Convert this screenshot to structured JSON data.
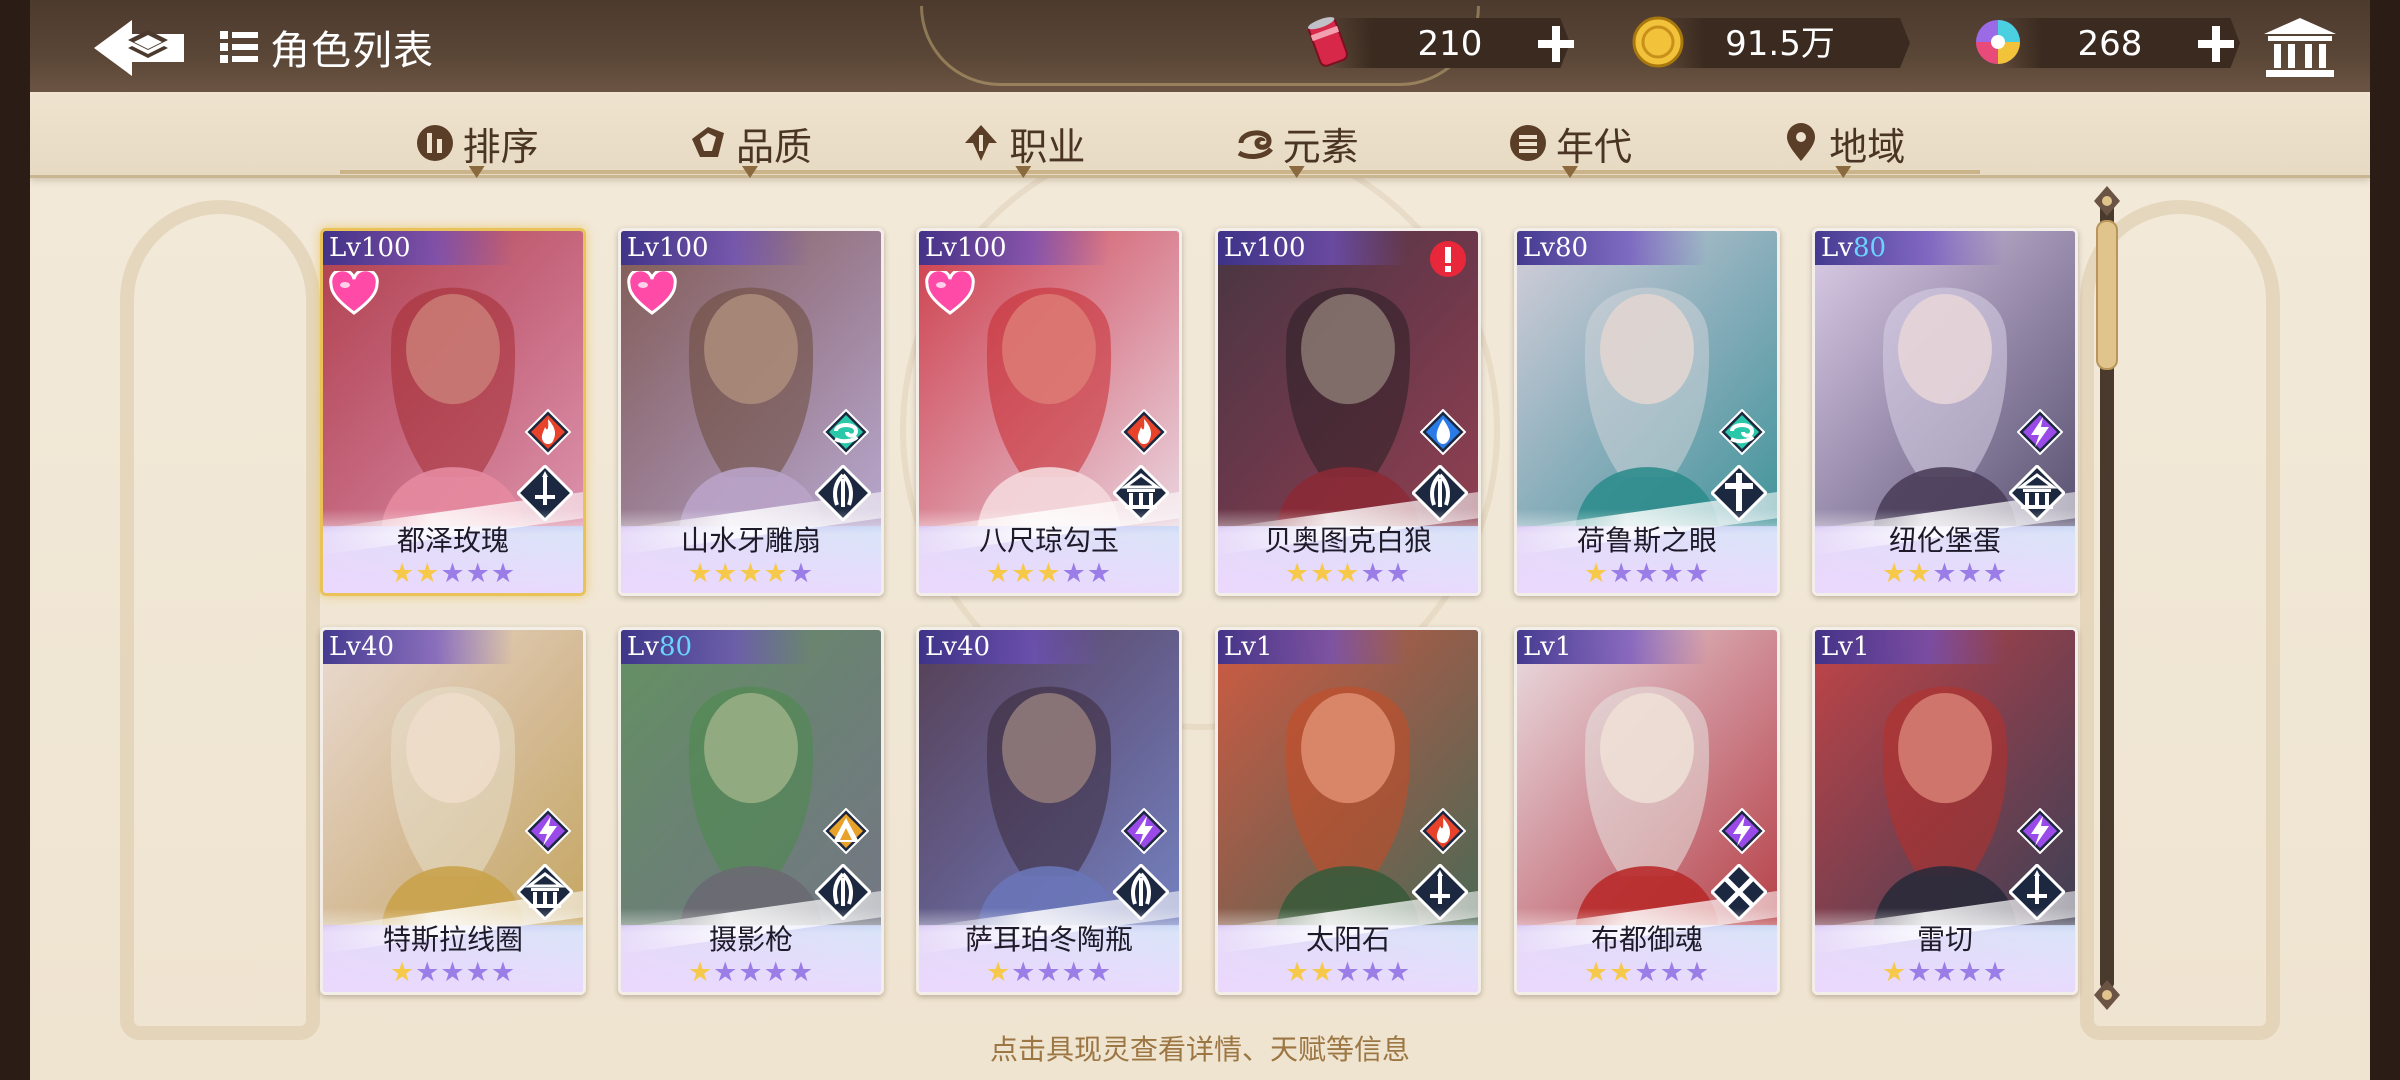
{
  "header": {
    "title": "角色列表",
    "resources": [
      {
        "icon": "energy-can-icon",
        "value": "210"
      },
      {
        "icon": "gold-coin-icon",
        "value": "91.5万"
      },
      {
        "icon": "crystal-orb-icon",
        "value": "268"
      }
    ]
  },
  "tabs": [
    {
      "label": "排序",
      "icon": "sort-icon"
    },
    {
      "label": "品质",
      "icon": "quality-icon"
    },
    {
      "label": "职业",
      "icon": "profession-icon"
    },
    {
      "label": "元素",
      "icon": "element-icon"
    },
    {
      "label": "年代",
      "icon": "era-icon"
    },
    {
      "label": "地域",
      "icon": "region-icon"
    }
  ],
  "cards": [
    {
      "lv_prefix": "Lv",
      "lv": "100",
      "lv_color": "white",
      "name": "都泽玫瑰",
      "stars": 5,
      "filled": 2,
      "element": "fire",
      "class": "sword",
      "heart": true,
      "alert": false,
      "frame": "gold",
      "bg": [
        "#a42b32",
        "#e58aa0"
      ]
    },
    {
      "lv_prefix": "Lv",
      "lv": "100",
      "lv_color": "white",
      "name": "山水牙雕扇",
      "stars": 5,
      "filled": 4,
      "element": "wind",
      "class": "claw",
      "heart": true,
      "alert": false,
      "frame": "normal",
      "bg": [
        "#6c4a3a",
        "#b9a3c8"
      ]
    },
    {
      "lv_prefix": "Lv",
      "lv": "100",
      "lv_color": "white",
      "name": "八尺琼勾玉",
      "stars": 5,
      "filled": 3,
      "element": "fire",
      "class": "temple",
      "heart": true,
      "alert": false,
      "frame": "normal",
      "bg": [
        "#c72a30",
        "#f4d8dc"
      ]
    },
    {
      "lv_prefix": "Lv",
      "lv": "100",
      "lv_color": "white",
      "name": "贝奥图克白狼",
      "stars": 5,
      "filled": 3,
      "element": "water",
      "class": "claw",
      "heart": false,
      "alert": true,
      "frame": "normal",
      "bg": [
        "#2a1f24",
        "#8b2a36"
      ]
    },
    {
      "lv_prefix": "Lv",
      "lv": "80",
      "lv_color": "white",
      "name": "荷鲁斯之眼",
      "stars": 5,
      "filled": 1,
      "element": "wind",
      "class": "cross",
      "heart": false,
      "alert": false,
      "frame": "normal",
      "bg": [
        "#cfd3d8",
        "#2f8c8c"
      ]
    },
    {
      "lv_prefix": "Lv",
      "lv": "80",
      "lv_color": "blue",
      "name": "纽伦堡蛋",
      "stars": 5,
      "filled": 2,
      "element": "thunder",
      "class": "temple",
      "heart": false,
      "alert": false,
      "frame": "normal",
      "bg": [
        "#d8d2e8",
        "#4a3e5a"
      ]
    },
    {
      "lv_prefix": "Lv",
      "lv": "40",
      "lv_color": "white",
      "name": "特斯拉线圈",
      "stars": 5,
      "filled": 1,
      "element": "thunder",
      "class": "temple",
      "heart": false,
      "alert": false,
      "frame": "normal",
      "bg": [
        "#e8e0cc",
        "#c9a24a"
      ]
    },
    {
      "lv_prefix": "Lv",
      "lv": "80",
      "lv_color": "blue",
      "name": "摄影枪",
      "stars": 5,
      "filled": 1,
      "element": "earth",
      "class": "claw",
      "heart": false,
      "alert": false,
      "frame": "normal",
      "bg": [
        "#4a8a4a",
        "#6a6a72"
      ]
    },
    {
      "lv_prefix": "Lv",
      "lv": "40",
      "lv_color": "white",
      "name": "萨耳珀冬陶瓶",
      "stars": 5,
      "filled": 1,
      "element": "thunder",
      "class": "claw",
      "heart": false,
      "alert": false,
      "frame": "normal",
      "bg": [
        "#3a2a3a",
        "#6a76b8"
      ]
    },
    {
      "lv_prefix": "Lv",
      "lv": "1",
      "lv_color": "white",
      "name": "太阳石",
      "stars": 5,
      "filled": 2,
      "element": "fire",
      "class": "sword",
      "heart": false,
      "alert": false,
      "frame": "normal",
      "bg": [
        "#c84a24",
        "#3a5a3a"
      ]
    },
    {
      "lv_prefix": "Lv",
      "lv": "1",
      "lv_color": "white",
      "name": "布都御魂",
      "stars": 5,
      "filled": 2,
      "element": "thunder",
      "class": "cross-swords",
      "heart": false,
      "alert": false,
      "frame": "normal",
      "bg": [
        "#e8e4e0",
        "#b82a2a"
      ]
    },
    {
      "lv_prefix": "Lv",
      "lv": "1",
      "lv_color": "white",
      "name": "雷切",
      "stars": 5,
      "filled": 1,
      "element": "thunder",
      "class": "sword",
      "heart": false,
      "alert": false,
      "frame": "normal",
      "bg": [
        "#b8302a",
        "#2a2a3a"
      ]
    }
  ],
  "hint": "点击具现灵查看详情、天赋等信息",
  "colors": {
    "topbar": "#4c3a2e",
    "frame": "#f3eadb",
    "accent_gold": "#e9c25a",
    "level_blue": "#6ad4ff"
  }
}
